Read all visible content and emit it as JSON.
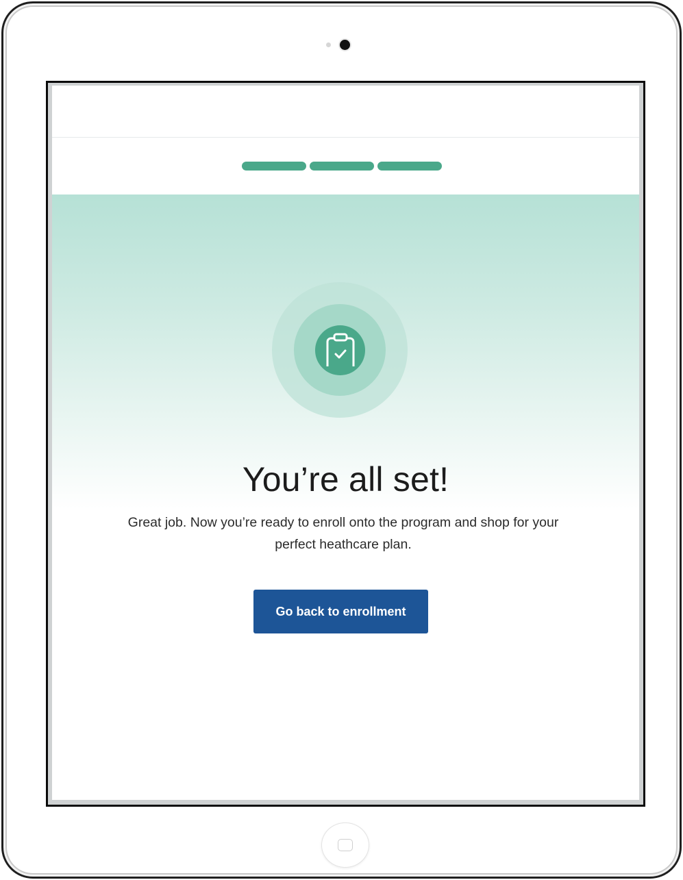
{
  "steps": {
    "total": 3,
    "completed": 3,
    "color": "#4aa88a"
  },
  "hero": {
    "icon": "clipboard-check-icon",
    "accent": "#4aa88a"
  },
  "confirmation": {
    "title": "You’re all set!",
    "message": "Great job. Now you’re ready to enroll onto the program and shop for your perfect heathcare plan."
  },
  "actions": {
    "back_label": "Go back to enrollment",
    "color": "#1d5597"
  }
}
